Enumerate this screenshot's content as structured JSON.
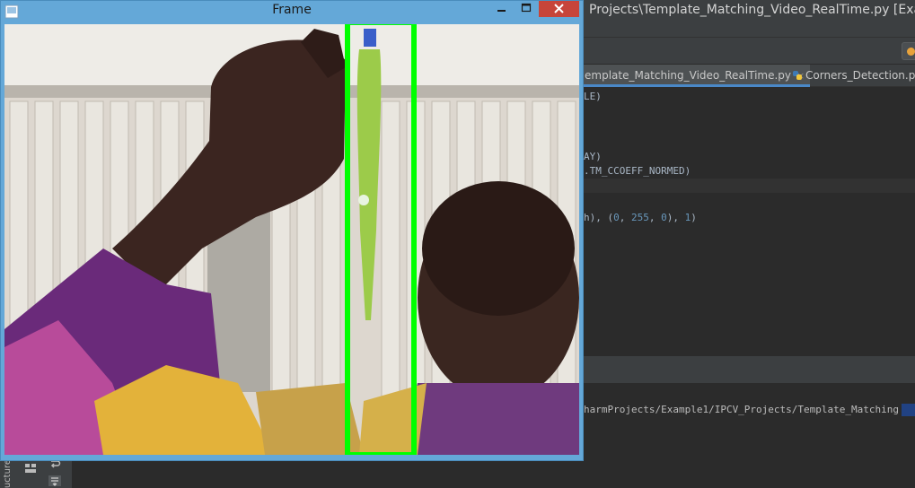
{
  "ide": {
    "window_title": "Projects\\Template_Matching_Video_RealTime.py [Exam",
    "tabs": [
      {
        "label": "emplate_Matching_Video_RealTime.py",
        "close": "×"
      },
      {
        "label": "Corners_Detection.py"
      }
    ],
    "code_lines": [
      {
        "text": "LE)"
      },
      {
        "text": "AY)"
      },
      {
        "text": ".TM_CCOEFF_NORMED)"
      },
      {
        "pre": "h), (",
        "n1": "0",
        "sep1": ", ",
        "n2": "255",
        "sep2": ", ",
        "n3": "0",
        "post": "), ",
        "n4": "1",
        "end": ")"
      }
    ],
    "console_text": "harmProjects/Example1/IPCV_Projects/Template_Matching",
    "structure_label": "Structure"
  },
  "frame": {
    "title": "Frame",
    "min_glyph": "—",
    "max_glyph": "☐",
    "close_glyph": "✕",
    "detection_color": "#00ff00"
  },
  "colors": {
    "ide_bg": "#2b2b2b",
    "ide_panel": "#3c3f41",
    "frame_chrome": "#64a8d8",
    "close_red": "#c7453a"
  },
  "icons": [
    "python-file-icon",
    "app-icon",
    "minimize-icon",
    "maximize-icon",
    "close-icon",
    "layout-icon",
    "wrap-icon"
  ]
}
